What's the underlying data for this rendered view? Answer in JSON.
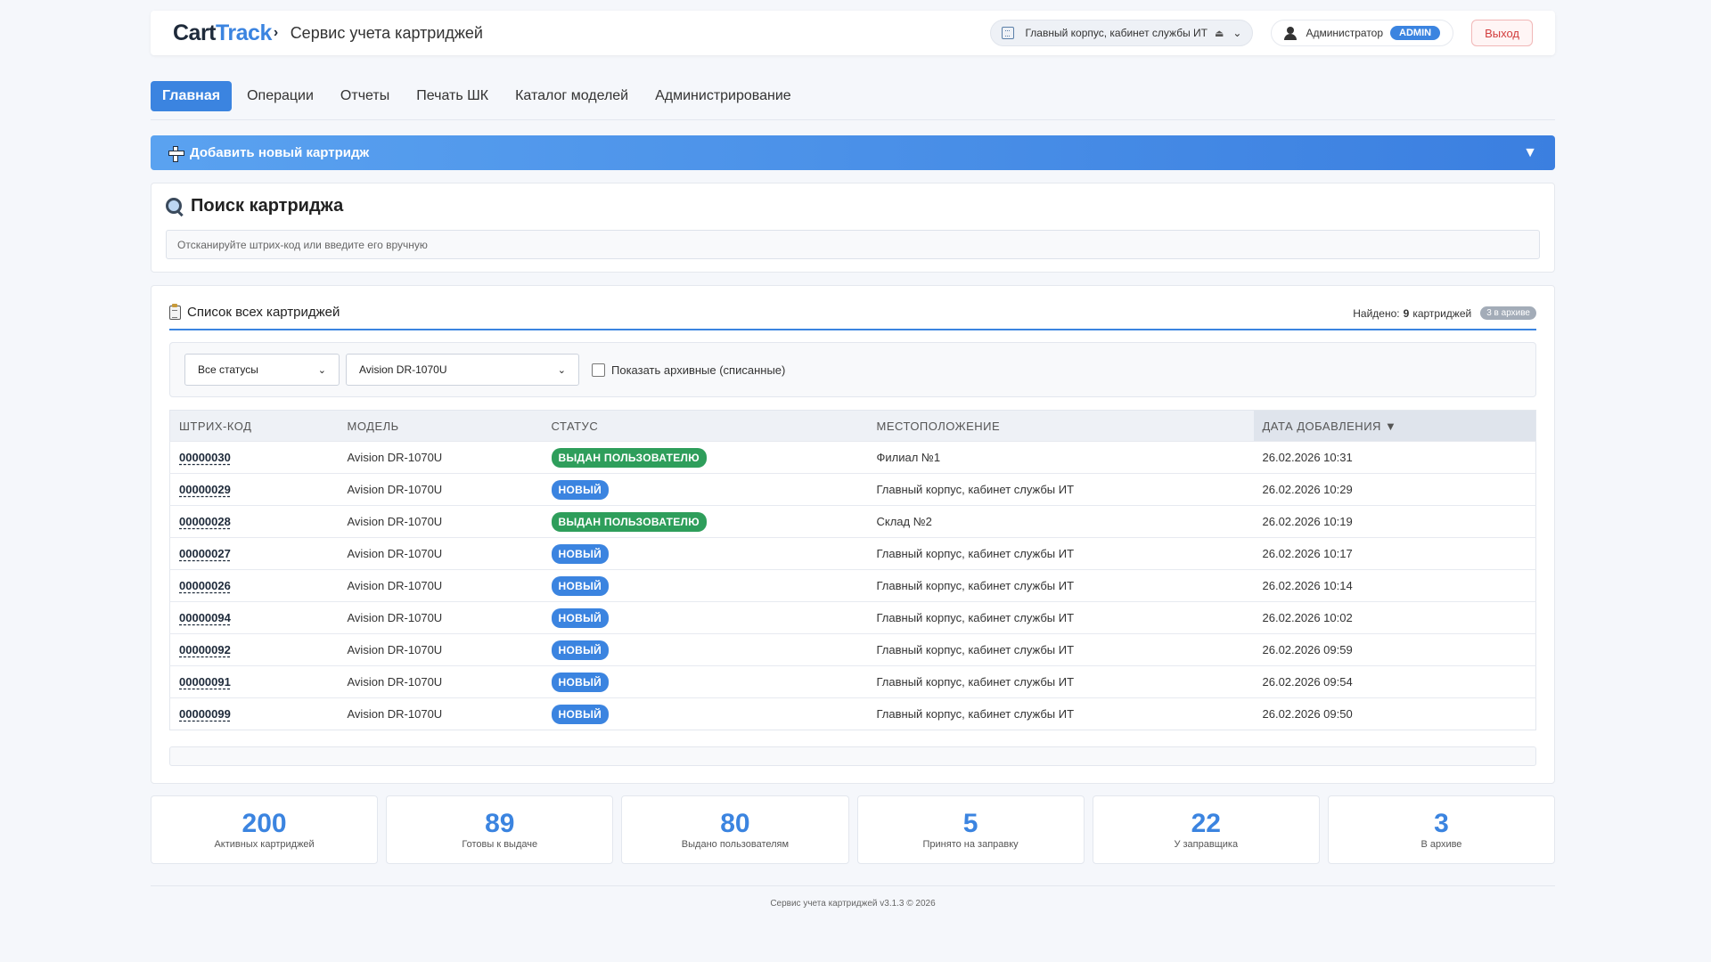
{
  "header": {
    "logo_main": "Cart",
    "logo_accent": "Track",
    "subtitle": "Сервис учета картриджей",
    "location": "Главный корпус, кабинет службы ИТ",
    "user": "Администратор",
    "role": "ADMIN",
    "logout": "Выход"
  },
  "nav": {
    "items": [
      {
        "label": "Главная"
      },
      {
        "label": "Операции"
      },
      {
        "label": "Отчеты"
      },
      {
        "label": "Печать ШК"
      },
      {
        "label": "Каталог моделей"
      },
      {
        "label": "Администрирование"
      }
    ]
  },
  "addbar": {
    "label": "Добавить новый картридж",
    "toggle": "▼"
  },
  "search": {
    "title": "Поиск картриджа",
    "placeholder": "Отсканируйте штрих-код или введите его вручную"
  },
  "list": {
    "title": "Список всех картриджей",
    "found_prefix": "Найдено:",
    "found_count": "9",
    "found_suffix": "картриджей",
    "archive_badge": "3 в архиве",
    "filter_status": "Все статусы",
    "filter_model": "Avision DR-1070U",
    "show_archived": "Показать архивные (списанные)",
    "columns": {
      "barcode": "Штрих-код",
      "model": "Модель",
      "status": "Статус",
      "location": "Местоположение",
      "date": "Дата добавления ▼"
    },
    "rows": [
      {
        "barcode": "00000030",
        "model": "Avision DR-1070U",
        "status": "ВЫДАН ПОЛЬЗОВАТЕЛЮ",
        "kind": "issued",
        "location": "Филиал №1",
        "date": "26.02.2026 10:31"
      },
      {
        "barcode": "00000029",
        "model": "Avision DR-1070U",
        "status": "НОВЫЙ",
        "kind": "new",
        "location": "Главный корпус, кабинет службы ИТ",
        "date": "26.02.2026 10:29"
      },
      {
        "barcode": "00000028",
        "model": "Avision DR-1070U",
        "status": "ВЫДАН ПОЛЬЗОВАТЕЛЮ",
        "kind": "issued",
        "location": "Склад №2",
        "date": "26.02.2026 10:19"
      },
      {
        "barcode": "00000027",
        "model": "Avision DR-1070U",
        "status": "НОВЫЙ",
        "kind": "new",
        "location": "Главный корпус, кабинет службы ИТ",
        "date": "26.02.2026 10:17"
      },
      {
        "barcode": "00000026",
        "model": "Avision DR-1070U",
        "status": "НОВЫЙ",
        "kind": "new",
        "location": "Главный корпус, кабинет службы ИТ",
        "date": "26.02.2026 10:14"
      },
      {
        "barcode": "00000094",
        "model": "Avision DR-1070U",
        "status": "НОВЫЙ",
        "kind": "new",
        "location": "Главный корпус, кабинет службы ИТ",
        "date": "26.02.2026 10:02"
      },
      {
        "barcode": "00000092",
        "model": "Avision DR-1070U",
        "status": "НОВЫЙ",
        "kind": "new",
        "location": "Главный корпус, кабинет службы ИТ",
        "date": "26.02.2026 09:59"
      },
      {
        "barcode": "00000091",
        "model": "Avision DR-1070U",
        "status": "НОВЫЙ",
        "kind": "new",
        "location": "Главный корпус, кабинет службы ИТ",
        "date": "26.02.2026 09:54"
      },
      {
        "barcode": "00000099",
        "model": "Avision DR-1070U",
        "status": "НОВЫЙ",
        "kind": "new",
        "location": "Главный корпус, кабинет службы ИТ",
        "date": "26.02.2026 09:50"
      }
    ]
  },
  "stats": [
    {
      "value": "200",
      "label": "Активных картриджей"
    },
    {
      "value": "89",
      "label": "Готовы к выдаче"
    },
    {
      "value": "80",
      "label": "Выдано пользователям"
    },
    {
      "value": "5",
      "label": "Принято на заправку"
    },
    {
      "value": "22",
      "label": "У заправщика"
    },
    {
      "value": "3",
      "label": "В архиве"
    }
  ],
  "footer": "Сервис учета картриджей v3.1.3 © 2026",
  "colors": {
    "accent": "#3b84e0",
    "issued": "#2e9e5b",
    "danger": "#d23c3c"
  }
}
